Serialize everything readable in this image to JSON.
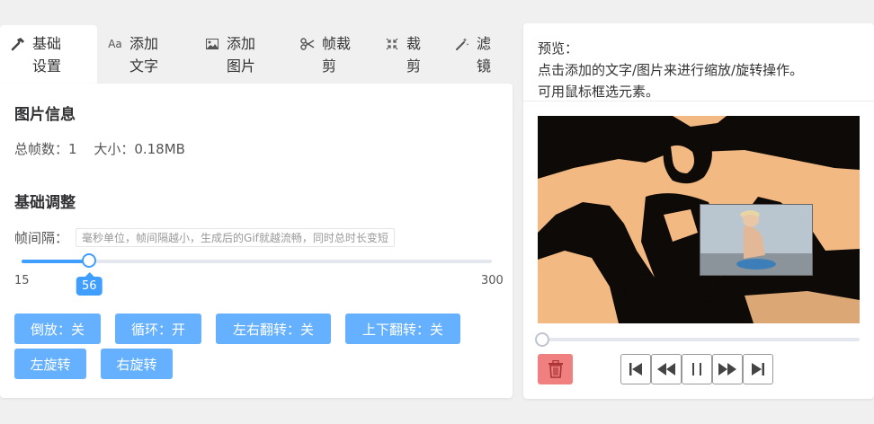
{
  "tabs": [
    {
      "label": "基础设置",
      "icon": "hammer-icon",
      "active": true
    },
    {
      "label": "添加文字",
      "icon": "font-icon",
      "active": false
    },
    {
      "label": "添加图片",
      "icon": "image-icon",
      "active": false
    },
    {
      "label": "帧裁剪",
      "icon": "scissors-icon",
      "active": false
    },
    {
      "label": "裁剪",
      "icon": "compress-icon",
      "active": false
    },
    {
      "label": "滤镜",
      "icon": "magic-wand-icon",
      "active": false
    }
  ],
  "image_info": {
    "title": "图片信息",
    "total_frames": "总帧数：1",
    "size": "大小：0.18MB"
  },
  "basic_adjust": {
    "title": "基础调整",
    "frame_interval_label": "帧间隔：",
    "frame_interval_hint": "毫秒单位，帧间隔越小，生成后的Gif就越流畅，同时总时长变短",
    "slider": {
      "min": "15",
      "max": "300",
      "value": "56",
      "min_num": 15,
      "max_num": 300,
      "value_num": 56
    }
  },
  "buttons": {
    "reverse": "倒放：关",
    "loop": "循环：开",
    "flip_h": "左右翻转：关",
    "flip_v": "上下翻转：关",
    "rotate_left": "左旋转",
    "rotate_right": "右旋转"
  },
  "preview": {
    "title": "预览：",
    "line1": "点击添加的文字/图片来进行缩放/旋转操作。",
    "line2": "可用鼠标框选元素。"
  },
  "playback": {
    "progress": 0
  },
  "colors": {
    "accent": "#409eff",
    "button_bg": "#66b1ff",
    "delete_bg": "#f08080",
    "image_tone": "#f2b982"
  }
}
